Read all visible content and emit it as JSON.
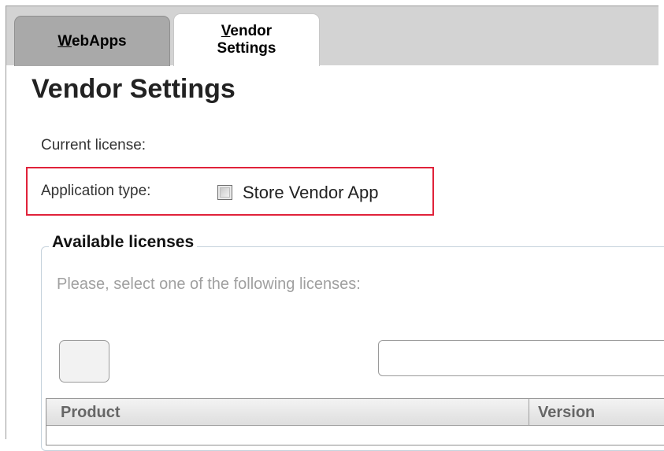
{
  "tabs": [
    {
      "label": "WebApps",
      "accesskey": "W",
      "rest": "ebApps"
    },
    {
      "label_line1_accesskey": "V",
      "label_line1_rest": "endor",
      "label_line2": "Settings"
    }
  ],
  "page": {
    "title": "Vendor Settings",
    "current_license_label": "Current license:",
    "application_type_label": "Application type:",
    "store_vendor_app_label": "Store Vendor App",
    "store_vendor_app_checked": false
  },
  "available_licenses": {
    "legend": "Available licenses",
    "hint": "Please, select one of the following licenses:",
    "columns": [
      "Product",
      "Version"
    ]
  },
  "colors": {
    "highlight": "#e0223a",
    "tab_inactive": "#a9a9a9",
    "tab_strip": "#d3d3d3"
  }
}
